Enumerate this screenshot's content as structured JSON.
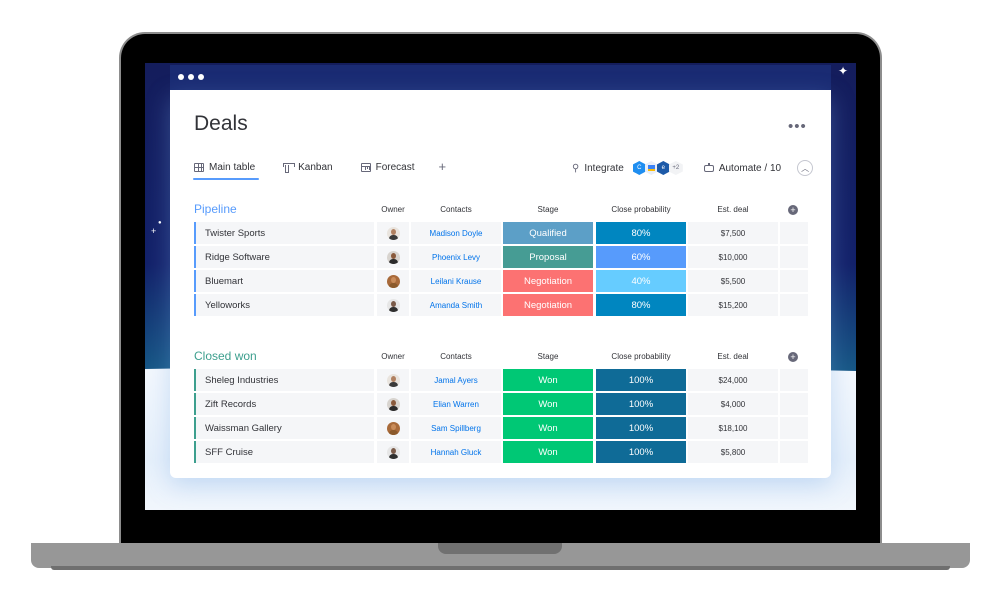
{
  "window": {
    "title": "Deals",
    "more_label": "•••"
  },
  "tabs": [
    {
      "label": "Main table",
      "icon": "table-icon",
      "active": true
    },
    {
      "label": "Kanban",
      "icon": "kanban-icon",
      "active": false
    },
    {
      "label": "Forecast",
      "icon": "forecast-icon",
      "active": false
    }
  ],
  "tab_add_label": "+",
  "toolbar": {
    "integrate_label": "Integrate",
    "integrations_more": "+2",
    "automate_label": "Automate / 10",
    "collapse_icon": "^"
  },
  "columns": {
    "owner": "Owner",
    "contacts": "Contacts",
    "stage": "Stage",
    "probability": "Close probability",
    "deal": "Est. deal",
    "add": "+"
  },
  "colors": {
    "pipeline_accent": "#579bfc",
    "closed_accent": "#3d9f8e",
    "qualified": "#5c9fc7",
    "proposal": "#469c94",
    "negotiation": "#fc7272",
    "won": "#00c875",
    "prob_80": "#0086c0",
    "prob_60": "#579bfc",
    "prob_40": "#66ccff",
    "prob_100": "#0f6b97"
  },
  "groups": [
    {
      "title": "Pipeline",
      "color": "#579bfc",
      "rows": [
        {
          "name": "Twister Sports",
          "owner": "avatar-1",
          "contact": "Madison Doyle",
          "stage": "Qualified",
          "stage_color": "#5c9fc7",
          "probability": "80%",
          "prob_color": "#0086c0",
          "deal": "$7,500"
        },
        {
          "name": "Ridge Software",
          "owner": "avatar-2",
          "contact": "Phoenix Levy",
          "stage": "Proposal",
          "stage_color": "#469c94",
          "probability": "60%",
          "prob_color": "#579bfc",
          "deal": "$10,000"
        },
        {
          "name": "Bluemart",
          "owner": "avatar-3",
          "contact": "Leilani Krause",
          "stage": "Negotiation",
          "stage_color": "#fc7272",
          "probability": "40%",
          "prob_color": "#66ccff",
          "deal": "$5,500"
        },
        {
          "name": "Yelloworks",
          "owner": "avatar-4",
          "contact": "Amanda Smith",
          "stage": "Negotiation",
          "stage_color": "#fc7272",
          "probability": "80%",
          "prob_color": "#0086c0",
          "deal": "$15,200"
        }
      ]
    },
    {
      "title": "Closed won",
      "color": "#3d9f8e",
      "rows": [
        {
          "name": "Sheleg Industries",
          "owner": "avatar-1",
          "contact": "Jamal Ayers",
          "stage": "Won",
          "stage_color": "#00c875",
          "probability": "100%",
          "prob_color": "#0f6b97",
          "deal": "$24,000"
        },
        {
          "name": "Zift Records",
          "owner": "avatar-2",
          "contact": "Elian Warren",
          "stage": "Won",
          "stage_color": "#00c875",
          "probability": "100%",
          "prob_color": "#0f6b97",
          "deal": "$4,000"
        },
        {
          "name": "Waissman Gallery",
          "owner": "avatar-3",
          "contact": "Sam Spillberg",
          "stage": "Won",
          "stage_color": "#00c875",
          "probability": "100%",
          "prob_color": "#0f6b97",
          "deal": "$18,100"
        },
        {
          "name": "SFF Cruise",
          "owner": "avatar-4",
          "contact": "Hannah Gluck",
          "stage": "Won",
          "stage_color": "#00c875",
          "probability": "100%",
          "prob_color": "#0f6b97",
          "deal": "$5,800"
        }
      ]
    }
  ]
}
